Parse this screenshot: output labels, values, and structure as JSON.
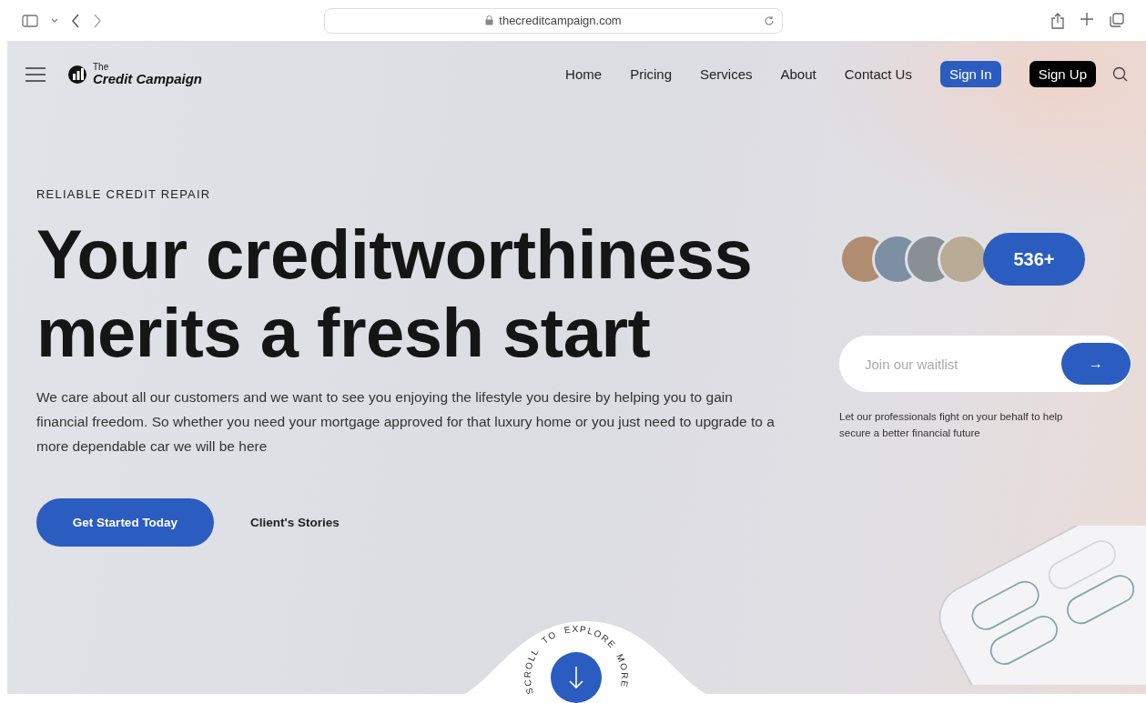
{
  "browser": {
    "url": "thecreditcampaign.com"
  },
  "nav": {
    "logo_small": "The",
    "logo": "Credit Campaign",
    "links": [
      "Home",
      "Pricing",
      "Services",
      "About",
      "Contact Us"
    ],
    "sign_in": "Sign In",
    "sign_up": "Sign Up"
  },
  "hero": {
    "eyebrow": "RELIABLE CREDIT REPAIR",
    "headline_lines": [
      "Your creditworthiness",
      "merits a fresh start"
    ],
    "body": "We care about all our customers and we want to see you enjoying the lifestyle you desire by helping you to gain financial freedom. So whether you need your mortgage approved for that luxury home or you just need to upgrade to a more dependable car we will be here",
    "primary_button": "Get Started Today",
    "secondary_link": "Client's Stories"
  },
  "waitlist": {
    "count": "536+",
    "placeholder": "Join our waitlist",
    "submit": "→",
    "note": "Let our professionals fight on your behalf to help secure a better financial future"
  },
  "scroll_cue": {
    "words": [
      "SCROLL",
      "TO",
      "EXPLORE",
      "MORE"
    ]
  }
}
